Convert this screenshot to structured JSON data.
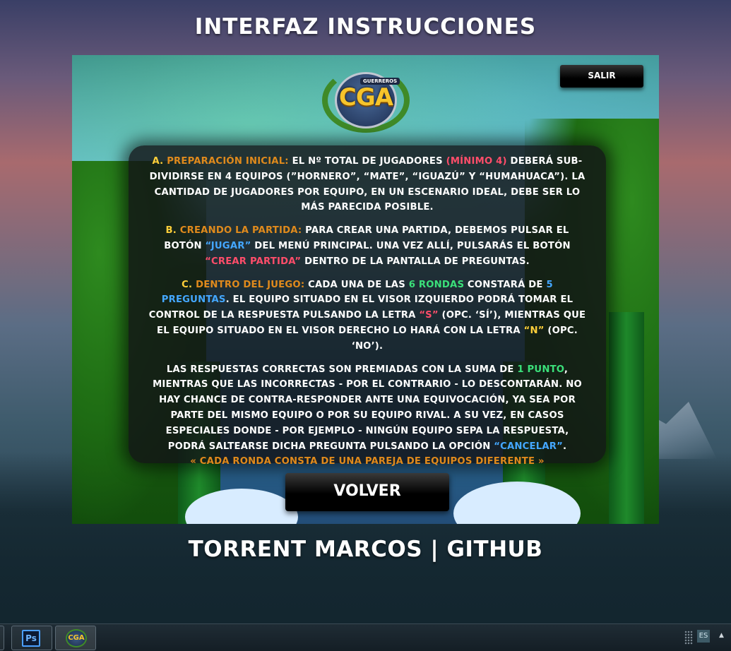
{
  "page": {
    "title": "INTERFAZ INSTRUCCIONES",
    "footer": "TORRENT MARCOS | GITHUB"
  },
  "game": {
    "logo": {
      "title": "CGA",
      "badge": "GUERREROS"
    },
    "exit_label": "SALIR",
    "back_label": "VOLVER",
    "instructions": {
      "a": {
        "prefix": "A.",
        "heading": "PREPARACIÓN INICIAL:",
        "t1": " EL Nº TOTAL DE JUGADORES ",
        "hl1": "(MÍNIMO 4)",
        "t2": " DEBERÁ SUB-DIVIDIRSE EN 4 EQUIPOS (”HORNERO”, “MATE”, “IGUAZÚ” Y “HUMAHUACA”). LA CANTIDAD DE JUGADORES POR EQUIPO, EN UN ESCENARIO IDEAL, DEBE SER LO MÁS PARECIDA POSIBLE."
      },
      "b": {
        "prefix": "B.",
        "heading": "CREANDO LA PARTIDA:",
        "t1": " PARA CREAR UNA PARTIDA, DEBEMOS PULSAR EL BOTÓN ",
        "hl1": "“JUGAR”",
        "t2": " DEL MENÚ PRINCIPAL. UNA VEZ ALLÍ, PULSARÁS EL BOTÓN ",
        "hl2": "“CREAR PARTIDA”",
        "t3": " DENTRO DE LA PANTALLA DE PREGUNTAS."
      },
      "c": {
        "prefix": "C.",
        "heading": "DENTRO DEL JUEGO:",
        "t1": " CADA UNA DE LAS ",
        "hl1": "6 RONDAS",
        "t2": " CONSTARÁ DE ",
        "hl2": "5 PREGUNTAS",
        "t3": ". EL EQUIPO SITUADO EN EL VISOR IZQUIERDO PODRÁ TOMAR EL CONTROL DE LA RESPUESTA PULSANDO LA LETRA ",
        "hl3": "“S”",
        "t4": " (OPC. ‘SÍ’), MIENTRAS QUE EL EQUIPO SITUADO EN EL VISOR DERECHO LO HARÁ CON LA LETRA ",
        "hl4": "“N”",
        "t5": " (OPC. ‘NO’)."
      },
      "d": {
        "t1": "LAS RESPUESTAS CORRECTAS SON PREMIADAS CON LA SUMA DE ",
        "hl1": "1 PUNTO",
        "t2": ", MIENTRAS QUE LAS INCORRECTAS - POR EL CONTRARIO - LO DESCONTARÁN. NO HAY CHANCE DE CONTRA-RESPONDER ANTE UNA EQUIVOCACIÓN, YA SEA POR PARTE DEL MISMO EQUIPO O POR SU EQUIPO RIVAL. A SU VEZ, EN CASOS ESPECIALES DONDE - POR EJEMPLO - NINGÚN EQUIPO SEPA LA RESPUESTA, PODRÁ SALTEARSE DICHA PREGUNTA PULSANDO LA OPCIÓN ",
        "hl2": "“CANCELAR”",
        "t3": ".",
        "closing": "« CADA RONDA CONSTA DE UNA PAREJA DE EQUIPOS DIFERENTE »"
      }
    }
  },
  "taskbar": {
    "apps": [
      {
        "name": "Photoshop",
        "icon": "Ps"
      },
      {
        "name": "CGA",
        "icon": "CGA"
      }
    ],
    "language": "ES"
  }
}
